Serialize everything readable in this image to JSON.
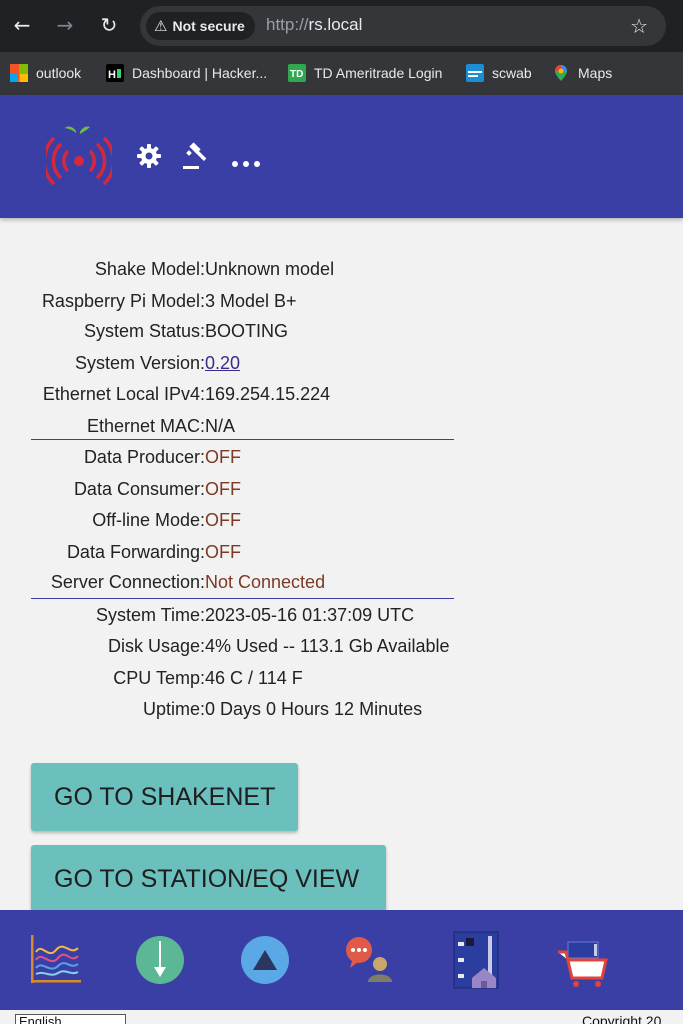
{
  "browser": {
    "back_icon": "arrow-left-icon",
    "forward_icon": "arrow-right-icon",
    "reload_icon": "reload-icon",
    "security_label": "Not secure",
    "url_scheme": "http://",
    "url_host": "rs.local",
    "bookmarks": [
      {
        "label": "outlook",
        "icon": "microsoft-icon"
      },
      {
        "label": "Dashboard | Hacker...",
        "icon": "hacker-icon"
      },
      {
        "label": "TD Ameritrade Login",
        "icon": "td-icon"
      },
      {
        "label": "scwab",
        "icon": "schwab-icon"
      },
      {
        "label": "Maps",
        "icon": "maps-icon"
      }
    ]
  },
  "header": {
    "logo_icon": "raspberry-shake-logo",
    "settings_icon": "gear-icon",
    "actions_icon": "gavel-icon",
    "more_icon": "more-dots-icon",
    "more_label": "..."
  },
  "info": {
    "rows": [
      {
        "label": "Shake Model",
        "value": "Unknown model"
      },
      {
        "label": "Raspberry Pi Model",
        "value": "3 Model B+"
      },
      {
        "label": "System Status",
        "value": "BOOTING"
      },
      {
        "label": "System Version",
        "value": "0.20"
      },
      {
        "label": "Ethernet Local IPv4",
        "value": "169.254.15.224"
      },
      {
        "label": "Ethernet MAC",
        "value": "N/A"
      },
      {
        "label": "Data Producer",
        "value": "OFF"
      },
      {
        "label": "Data Consumer",
        "value": "OFF"
      },
      {
        "label": "Off-line Mode",
        "value": "OFF"
      },
      {
        "label": "Data Forwarding",
        "value": "OFF"
      },
      {
        "label": "Server Connection",
        "value": "Not Connected"
      },
      {
        "label": "System Time",
        "value": "2023-05-16 01:37:09 UTC"
      },
      {
        "label": "Disk Usage",
        "value": "4% Used -- 113.1 Gb Available"
      },
      {
        "label": "CPU Temp",
        "value": "46 C / 114 F"
      },
      {
        "label": "Uptime",
        "value": "0 Days 0 Hours 12 Minutes"
      }
    ],
    "separator": ":"
  },
  "buttons": {
    "shakenet": "GO TO SHAKENET",
    "station_view": "GO TO STATION/EQ VIEW"
  },
  "bottom_bar": {
    "icons": [
      "waveform-chart-icon",
      "download-arrow-icon",
      "upload-triangle-icon",
      "user-chat-icon",
      "device-home-icon",
      "shop-cart-icon"
    ]
  },
  "footer": {
    "language": "English",
    "copyright": "Copyright 20"
  },
  "colors": {
    "header_bg": "#3a3fa5",
    "button_bg": "#6bbfbd",
    "off_text": "#7a3a24"
  }
}
